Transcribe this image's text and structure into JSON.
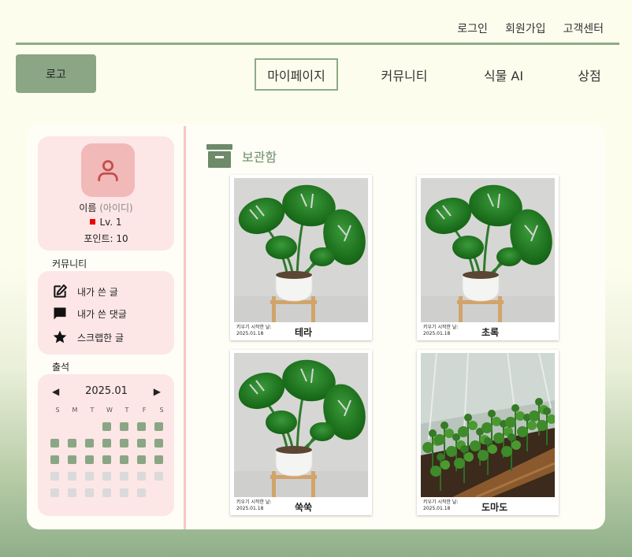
{
  "top_links": {
    "login": "로그인",
    "signup": "회원가입",
    "support": "고객센터"
  },
  "logo": "로고",
  "nav": {
    "mypage": "마이페이지",
    "community": "커뮤니티",
    "plant_ai": "식물 AI",
    "shop": "상점"
  },
  "profile": {
    "name": "이름",
    "id": "(아이디)",
    "level": "Lv. 1",
    "points": "포인트: 10",
    "level_color": "#e00000"
  },
  "community": {
    "title": "커뮤니티",
    "items": [
      {
        "label": "내가 쓴 글",
        "icon": "edit-icon"
      },
      {
        "label": "내가 쓴 댓글",
        "icon": "comment-icon"
      },
      {
        "label": "스크랩한 글",
        "icon": "star-icon"
      }
    ]
  },
  "attendance": {
    "title": "출석",
    "month": "2025.01",
    "weekdays": [
      "S",
      "M",
      "T",
      "W",
      "T",
      "F",
      "S"
    ],
    "first_weekday": 3,
    "days_in_month": 31,
    "attended_through": 18,
    "on_color": "#8aa685",
    "off_color": "#dadada"
  },
  "storage": {
    "title": "보관함",
    "icon": "archive-icon",
    "plants": [
      {
        "name": "테라",
        "start_label": "키우기 시작한 날:",
        "start_date": "2025.01.18",
        "image": "monstera-photo"
      },
      {
        "name": "초록",
        "start_label": "키우기 시작한 날:",
        "start_date": "2025.01.18",
        "image": "monstera-photo"
      },
      {
        "name": "쑥쑥",
        "start_label": "키우기 시작한 날:",
        "start_date": "2025.01.18",
        "image": "monstera-photo"
      },
      {
        "name": "도마도",
        "start_label": "키우기 시작한 날:",
        "start_date": "2025.01.18",
        "image": "tomato-greenhouse-photo"
      }
    ]
  },
  "colors": {
    "accent": "#8eaa88",
    "panel_pink": "#fde6e6",
    "avatar_pink": "#f2b9b9"
  }
}
